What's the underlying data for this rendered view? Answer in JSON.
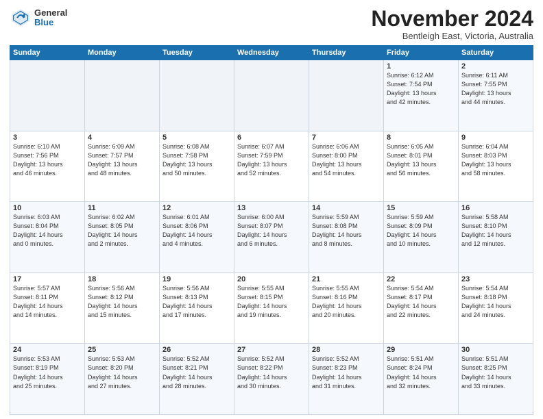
{
  "logo": {
    "general": "General",
    "blue": "Blue"
  },
  "header": {
    "month": "November 2024",
    "location": "Bentleigh East, Victoria, Australia"
  },
  "weekdays": [
    "Sunday",
    "Monday",
    "Tuesday",
    "Wednesday",
    "Thursday",
    "Friday",
    "Saturday"
  ],
  "weeks": [
    [
      {
        "day": "",
        "text": ""
      },
      {
        "day": "",
        "text": ""
      },
      {
        "day": "",
        "text": ""
      },
      {
        "day": "",
        "text": ""
      },
      {
        "day": "",
        "text": ""
      },
      {
        "day": "1",
        "text": "Sunrise: 6:12 AM\nSunset: 7:54 PM\nDaylight: 13 hours\nand 42 minutes."
      },
      {
        "day": "2",
        "text": "Sunrise: 6:11 AM\nSunset: 7:55 PM\nDaylight: 13 hours\nand 44 minutes."
      }
    ],
    [
      {
        "day": "3",
        "text": "Sunrise: 6:10 AM\nSunset: 7:56 PM\nDaylight: 13 hours\nand 46 minutes."
      },
      {
        "day": "4",
        "text": "Sunrise: 6:09 AM\nSunset: 7:57 PM\nDaylight: 13 hours\nand 48 minutes."
      },
      {
        "day": "5",
        "text": "Sunrise: 6:08 AM\nSunset: 7:58 PM\nDaylight: 13 hours\nand 50 minutes."
      },
      {
        "day": "6",
        "text": "Sunrise: 6:07 AM\nSunset: 7:59 PM\nDaylight: 13 hours\nand 52 minutes."
      },
      {
        "day": "7",
        "text": "Sunrise: 6:06 AM\nSunset: 8:00 PM\nDaylight: 13 hours\nand 54 minutes."
      },
      {
        "day": "8",
        "text": "Sunrise: 6:05 AM\nSunset: 8:01 PM\nDaylight: 13 hours\nand 56 minutes."
      },
      {
        "day": "9",
        "text": "Sunrise: 6:04 AM\nSunset: 8:03 PM\nDaylight: 13 hours\nand 58 minutes."
      }
    ],
    [
      {
        "day": "10",
        "text": "Sunrise: 6:03 AM\nSunset: 8:04 PM\nDaylight: 14 hours\nand 0 minutes."
      },
      {
        "day": "11",
        "text": "Sunrise: 6:02 AM\nSunset: 8:05 PM\nDaylight: 14 hours\nand 2 minutes."
      },
      {
        "day": "12",
        "text": "Sunrise: 6:01 AM\nSunset: 8:06 PM\nDaylight: 14 hours\nand 4 minutes."
      },
      {
        "day": "13",
        "text": "Sunrise: 6:00 AM\nSunset: 8:07 PM\nDaylight: 14 hours\nand 6 minutes."
      },
      {
        "day": "14",
        "text": "Sunrise: 5:59 AM\nSunset: 8:08 PM\nDaylight: 14 hours\nand 8 minutes."
      },
      {
        "day": "15",
        "text": "Sunrise: 5:59 AM\nSunset: 8:09 PM\nDaylight: 14 hours\nand 10 minutes."
      },
      {
        "day": "16",
        "text": "Sunrise: 5:58 AM\nSunset: 8:10 PM\nDaylight: 14 hours\nand 12 minutes."
      }
    ],
    [
      {
        "day": "17",
        "text": "Sunrise: 5:57 AM\nSunset: 8:11 PM\nDaylight: 14 hours\nand 14 minutes."
      },
      {
        "day": "18",
        "text": "Sunrise: 5:56 AM\nSunset: 8:12 PM\nDaylight: 14 hours\nand 15 minutes."
      },
      {
        "day": "19",
        "text": "Sunrise: 5:56 AM\nSunset: 8:13 PM\nDaylight: 14 hours\nand 17 minutes."
      },
      {
        "day": "20",
        "text": "Sunrise: 5:55 AM\nSunset: 8:15 PM\nDaylight: 14 hours\nand 19 minutes."
      },
      {
        "day": "21",
        "text": "Sunrise: 5:55 AM\nSunset: 8:16 PM\nDaylight: 14 hours\nand 20 minutes."
      },
      {
        "day": "22",
        "text": "Sunrise: 5:54 AM\nSunset: 8:17 PM\nDaylight: 14 hours\nand 22 minutes."
      },
      {
        "day": "23",
        "text": "Sunrise: 5:54 AM\nSunset: 8:18 PM\nDaylight: 14 hours\nand 24 minutes."
      }
    ],
    [
      {
        "day": "24",
        "text": "Sunrise: 5:53 AM\nSunset: 8:19 PM\nDaylight: 14 hours\nand 25 minutes."
      },
      {
        "day": "25",
        "text": "Sunrise: 5:53 AM\nSunset: 8:20 PM\nDaylight: 14 hours\nand 27 minutes."
      },
      {
        "day": "26",
        "text": "Sunrise: 5:52 AM\nSunset: 8:21 PM\nDaylight: 14 hours\nand 28 minutes."
      },
      {
        "day": "27",
        "text": "Sunrise: 5:52 AM\nSunset: 8:22 PM\nDaylight: 14 hours\nand 30 minutes."
      },
      {
        "day": "28",
        "text": "Sunrise: 5:52 AM\nSunset: 8:23 PM\nDaylight: 14 hours\nand 31 minutes."
      },
      {
        "day": "29",
        "text": "Sunrise: 5:51 AM\nSunset: 8:24 PM\nDaylight: 14 hours\nand 32 minutes."
      },
      {
        "day": "30",
        "text": "Sunrise: 5:51 AM\nSunset: 8:25 PM\nDaylight: 14 hours\nand 33 minutes."
      }
    ]
  ]
}
